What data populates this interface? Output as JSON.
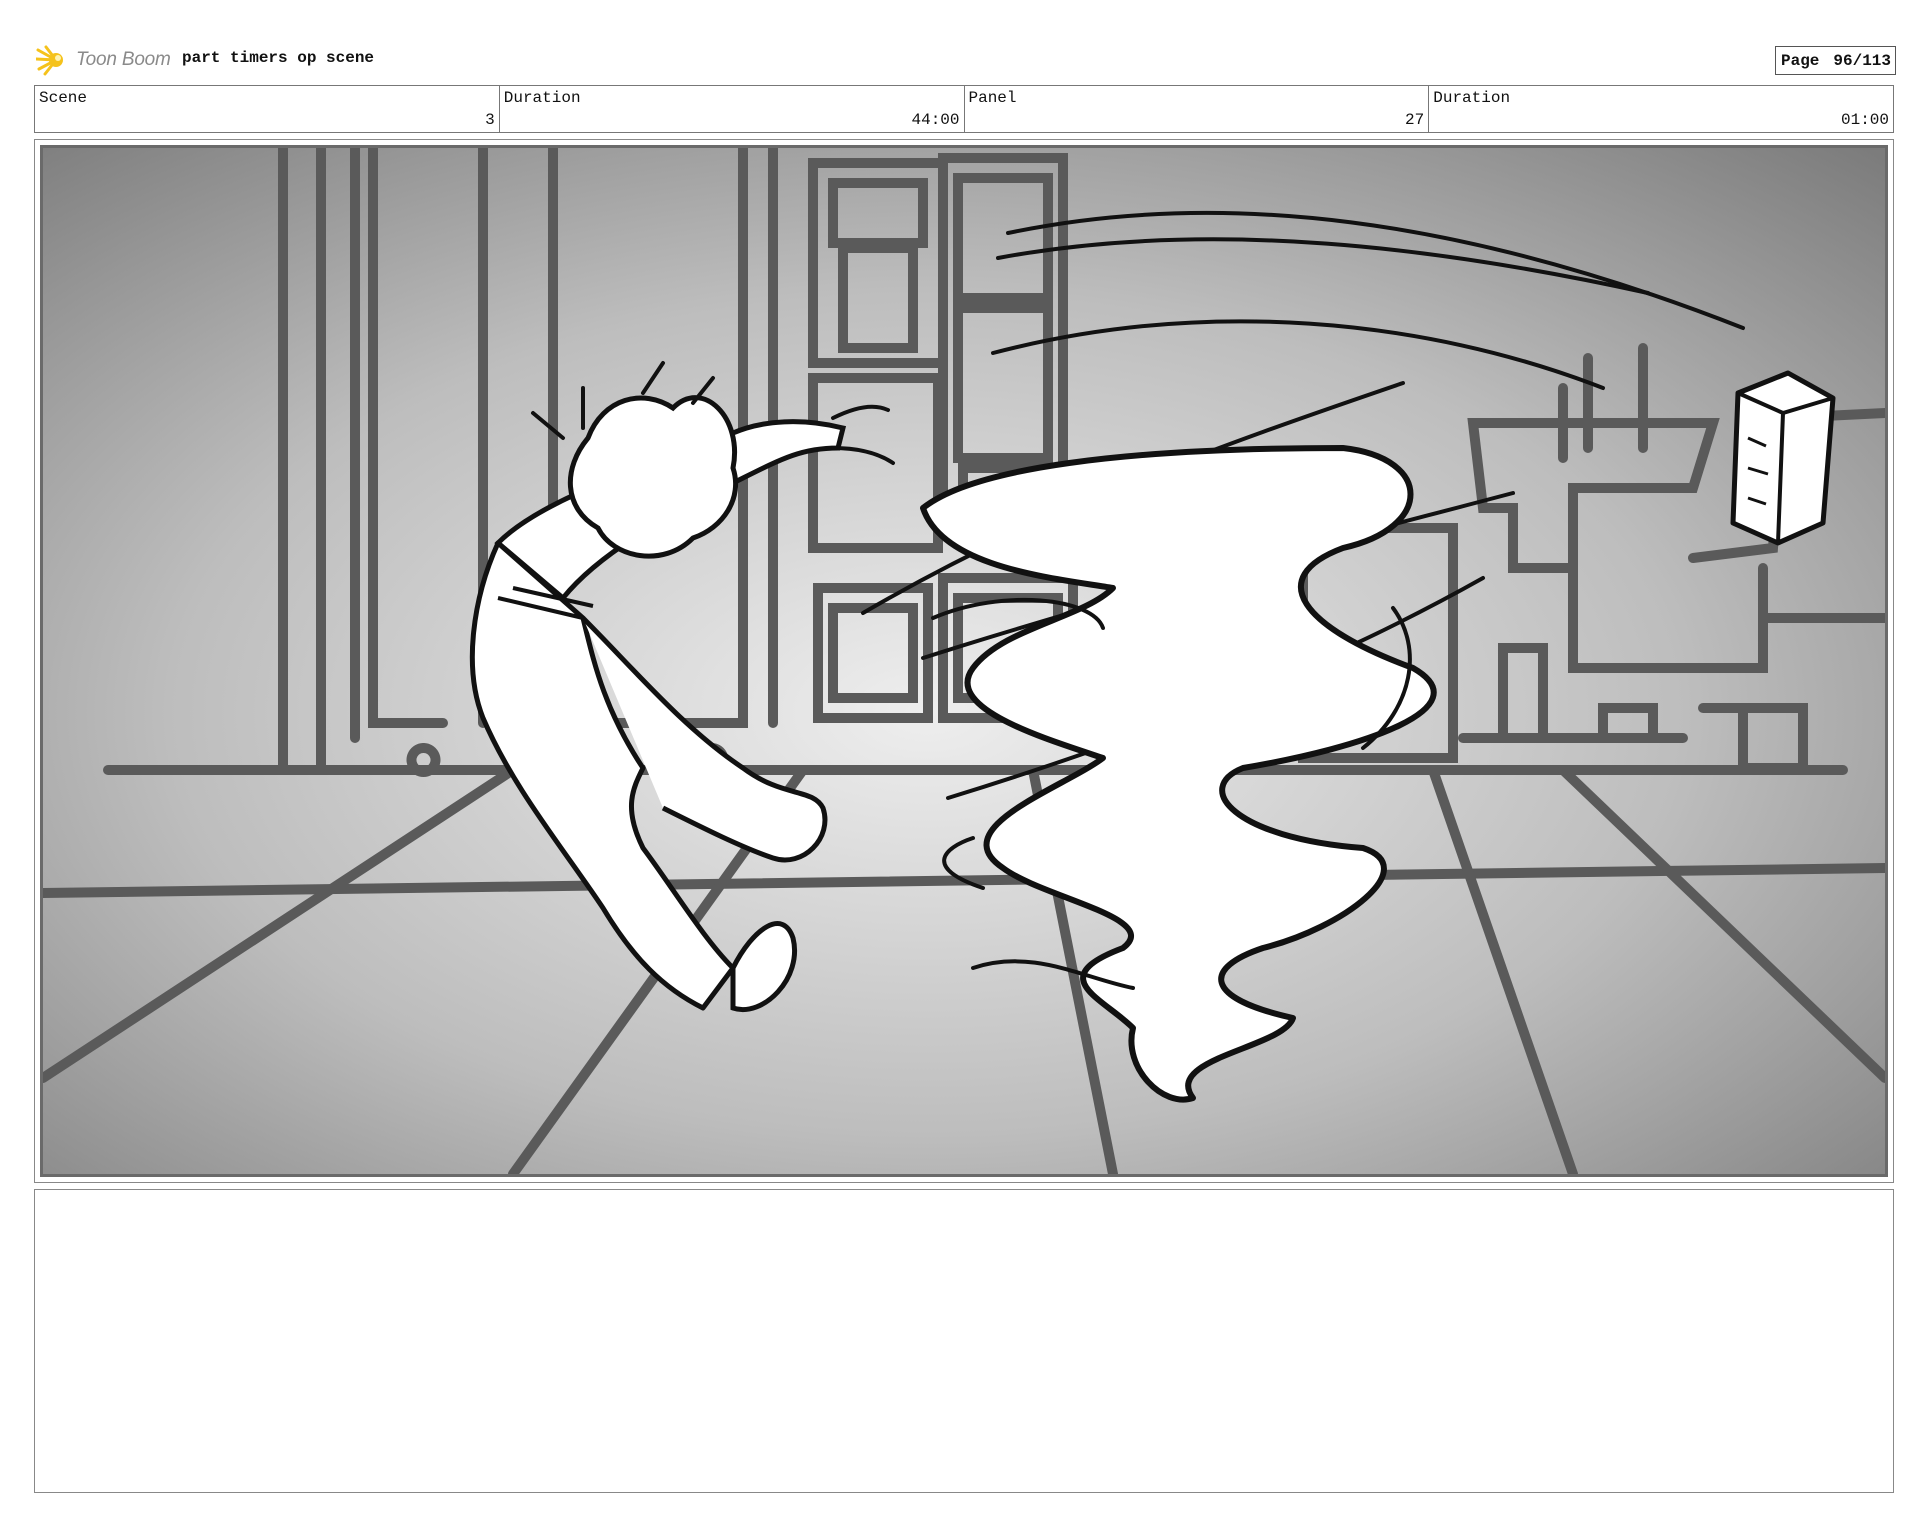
{
  "header": {
    "brand": "Toon Boom",
    "project_title": "part timers op scene",
    "page_label": "Page",
    "page_value": "96/113"
  },
  "info": {
    "scene_label": "Scene",
    "scene_value": "3",
    "scene_duration_label": "Duration",
    "scene_duration_value": "44:00",
    "panel_label": "Panel",
    "panel_value": "27",
    "panel_duration_label": "Duration",
    "panel_duration_value": "01:00"
  },
  "panel": {
    "content": "storyboard sketch"
  },
  "notes": {
    "text": ""
  }
}
